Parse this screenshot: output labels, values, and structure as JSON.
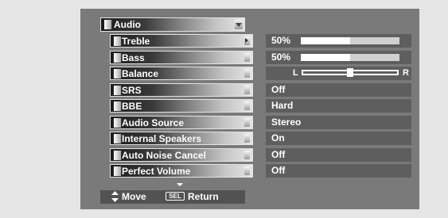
{
  "menu": {
    "title": "Audio",
    "more_below": true,
    "rows": [
      {
        "id": "treble",
        "label": "Treble",
        "value": "50%",
        "type": "slider",
        "level": 0.5,
        "active": true
      },
      {
        "id": "bass",
        "label": "Bass",
        "value": "50%",
        "type": "slider",
        "level": 0.5
      },
      {
        "id": "balance",
        "label": "Balance",
        "type": "balance",
        "left_label": "L",
        "right_label": "R",
        "level": 0.5
      },
      {
        "id": "srs",
        "label": "SRS",
        "value": "Off",
        "type": "text"
      },
      {
        "id": "bbe",
        "label": "BBE",
        "value": "Hard",
        "type": "text"
      },
      {
        "id": "audio-source",
        "label": "Audio Source",
        "value": "Stereo",
        "type": "text"
      },
      {
        "id": "internal-speakers",
        "label": "Internal Speakers",
        "value": "On",
        "type": "text"
      },
      {
        "id": "auto-noise-cancel",
        "label": "Auto Noise Cancel",
        "value": "Off",
        "type": "text"
      },
      {
        "id": "perfect-volume",
        "label": "Perfect Volume",
        "value": "Off",
        "type": "text"
      }
    ]
  },
  "footer": {
    "move_icon": "up-down-arrow-icon",
    "move_label": "Move",
    "sel_key": "SEL",
    "return_label": "Return"
  },
  "colors": {
    "page_bg": "#e6e6e6",
    "panel_bg": "#7a7a7a",
    "value_bg": "#5e5e5e",
    "footer_bg": "#525252",
    "text": "#ffffff"
  }
}
